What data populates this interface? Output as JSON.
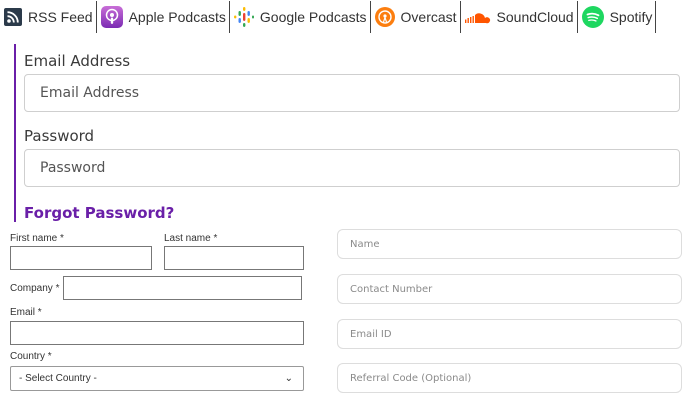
{
  "podcast_links": [
    {
      "label": "RSS Feed",
      "icon": "rss-icon"
    },
    {
      "label": "Apple Podcasts",
      "icon": "apple-podcasts-icon"
    },
    {
      "label": "Google Podcasts",
      "icon": "google-podcasts-icon"
    },
    {
      "label": "Overcast",
      "icon": "overcast-icon"
    },
    {
      "label": "SoundCloud",
      "icon": "soundcloud-icon"
    },
    {
      "label": "Spotify",
      "icon": "spotify-icon"
    }
  ],
  "login": {
    "email_label": "Email Address",
    "email_placeholder": "Email Address",
    "password_label": "Password",
    "password_placeholder": "Password",
    "forgot_link": "Forgot Password?"
  },
  "registration": {
    "first_name_label": "First name *",
    "last_name_label": "Last name *",
    "company_label": "Company *",
    "email_label": "Email *",
    "country_label": "Country *",
    "country_selected": "- Select Country -"
  },
  "contact_form": {
    "name_placeholder": "Name",
    "contact_placeholder": "Contact Number",
    "email_placeholder": "Email ID",
    "referral_placeholder": "Referral Code (Optional)"
  },
  "colors": {
    "accent": "#6a1fa8",
    "rss": "#2b3a4a",
    "apple_podcasts": "#9b3fc8",
    "overcast": "#fc7e0f",
    "soundcloud": "#ff5500",
    "spotify": "#1ed760"
  }
}
